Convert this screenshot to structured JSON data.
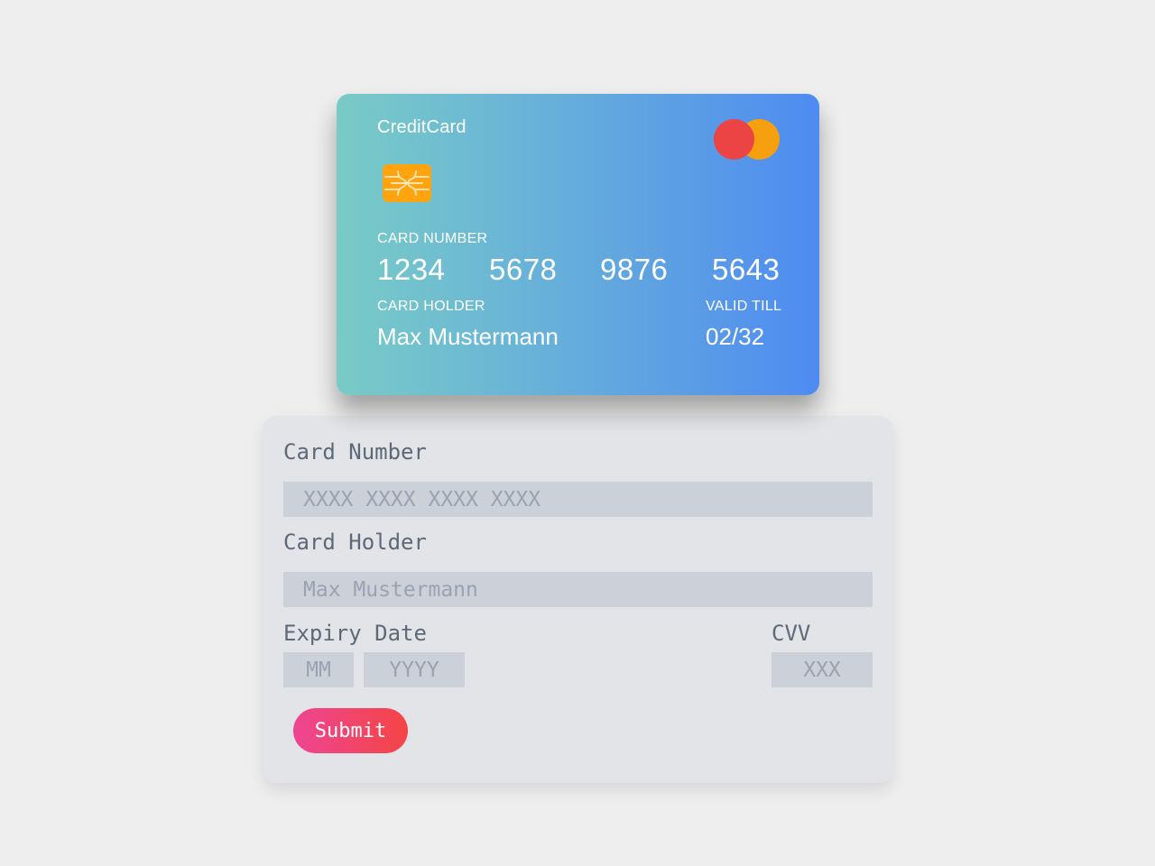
{
  "card": {
    "title": "CreditCard",
    "brand_icon": "mastercard-logo-icon",
    "chip_icon": "emv-chip-icon",
    "number_label": "CARD NUMBER",
    "number_groups": [
      "1234",
      "5678",
      "9876",
      "5643"
    ],
    "holder_label": "CARD HOLDER",
    "holder_name": "Max Mustermann",
    "valid_label": "VALID TILL",
    "valid_value": "02/32",
    "gradient_colors": [
      "#79cbc6",
      "#4e8bf2"
    ],
    "logo_colors": [
      "#ec4444",
      "#f6a00f"
    ],
    "chip_color": "#ffa40f"
  },
  "form": {
    "card_number": {
      "label": "Card Number",
      "placeholder": "XXXX XXXX XXXX XXXX",
      "value": ""
    },
    "card_holder": {
      "label": "Card Holder",
      "placeholder": "Max Mustermann",
      "value": ""
    },
    "expiry": {
      "label": "Expiry Date",
      "month_placeholder": "MM",
      "year_placeholder": "YYYY"
    },
    "cvv": {
      "label": "CVV",
      "placeholder": "XXX"
    },
    "submit_label": "Submit",
    "submit_gradient": [
      "#ee4593",
      "#f44545"
    ]
  }
}
